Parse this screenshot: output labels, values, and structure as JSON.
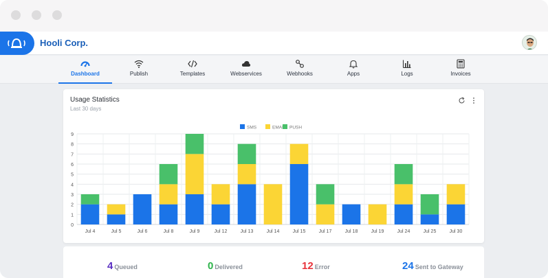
{
  "app": {
    "title": "Hooli Corp."
  },
  "nav": {
    "items": [
      {
        "label": "Dashboard",
        "icon": "dashboard-gauge-icon",
        "active": true
      },
      {
        "label": "Publish",
        "icon": "wifi-broadcast-icon"
      },
      {
        "label": "Templates",
        "icon": "code-icon"
      },
      {
        "label": "Webservices",
        "icon": "cloud-icon"
      },
      {
        "label": "Webhooks",
        "icon": "webhook-link-icon"
      },
      {
        "label": "Apps",
        "icon": "bell-icon"
      },
      {
        "label": "Logs",
        "icon": "bar-chart-icon"
      },
      {
        "label": "Invoices",
        "icon": "calculator-icon"
      }
    ]
  },
  "usage": {
    "title": "Usage Statistics",
    "subtitle": "Last 30 days"
  },
  "chart_data": {
    "type": "bar",
    "stacked": true,
    "categories": [
      "Jul 4",
      "Jul 5",
      "Jul 6",
      "Jul 8",
      "Jul 9",
      "Jul 12",
      "Jul 13",
      "Jul 14",
      "Jul 15",
      "Jul 17",
      "Jul 18",
      "Jul 19",
      "Jul 24",
      "Jul 25",
      "Jul 30"
    ],
    "series": [
      {
        "name": "SMS",
        "color": "#1b74e8",
        "values": [
          2,
          1,
          3,
          2,
          3,
          2,
          4,
          0,
          6,
          0,
          2,
          0,
          2,
          1,
          2
        ]
      },
      {
        "name": "EMAIL",
        "color": "#fbd535",
        "values": [
          0,
          1,
          0,
          2,
          4,
          2,
          2,
          4,
          2,
          2,
          0,
          2,
          2,
          0,
          2
        ]
      },
      {
        "name": "PUSH",
        "color": "#49c06a",
        "values": [
          1,
          0,
          0,
          2,
          2,
          0,
          2,
          0,
          0,
          2,
          0,
          0,
          2,
          2,
          0
        ]
      }
    ],
    "ylim": [
      0,
      9
    ],
    "yticks": [
      0,
      1,
      2,
      3,
      4,
      5,
      6,
      7,
      8,
      9
    ],
    "grid": true,
    "legend": "top-center"
  },
  "stats": {
    "items": [
      {
        "value": "4",
        "label": "Queued",
        "color": "#5a2fc2"
      },
      {
        "value": "0",
        "label": "Delivered",
        "color": "#2db34a"
      },
      {
        "value": "12",
        "label": "Error",
        "color": "#e8333b"
      },
      {
        "value": "24",
        "label": "Sent to Gateway",
        "color": "#1b74e8"
      }
    ]
  }
}
